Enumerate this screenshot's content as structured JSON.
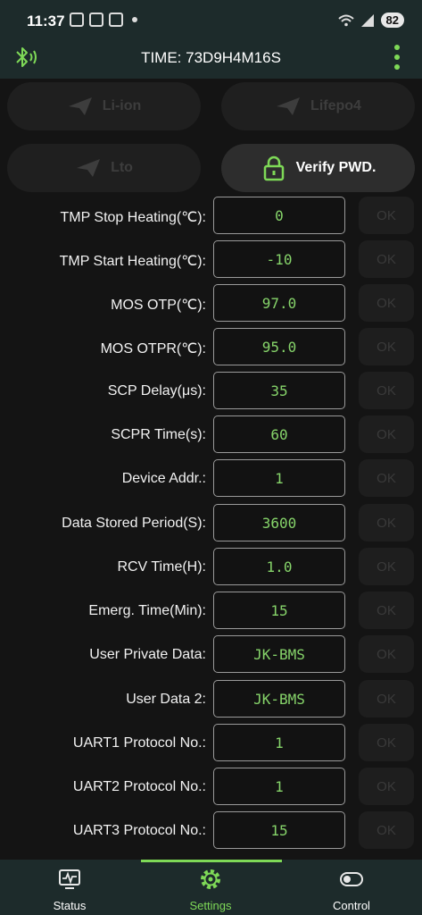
{
  "status_bar": {
    "time": "11:37",
    "battery": "82"
  },
  "app_bar": {
    "title": "TIME: 73D9H4M16S"
  },
  "presets": [
    {
      "label": "Li-ion"
    },
    {
      "label": "Lifepo4"
    },
    {
      "label": "Lto"
    }
  ],
  "verify_button": {
    "label": "Verify PWD."
  },
  "ok_label": "OK",
  "settings": [
    {
      "label": "TMP Stop Heating(℃):",
      "value": "0"
    },
    {
      "label": "TMP Start Heating(℃):",
      "value": "-10"
    },
    {
      "label": "MOS OTP(℃):",
      "value": "97.0"
    },
    {
      "label": "MOS OTPR(℃):",
      "value": "95.0"
    },
    {
      "label": "SCP Delay(μs):",
      "value": "35"
    },
    {
      "label": "SCPR Time(s):",
      "value": "60"
    },
    {
      "label": "Device Addr.:",
      "value": "1"
    },
    {
      "label": "Data Stored Period(S):",
      "value": "3600"
    },
    {
      "label": "RCV Time(H):",
      "value": "1.0"
    },
    {
      "label": "Emerg. Time(Min):",
      "value": "15"
    },
    {
      "label": "User Private Data:",
      "value": "JK-BMS"
    },
    {
      "label": "User Data 2:",
      "value": "JK-BMS"
    },
    {
      "label": "UART1 Protocol No.:",
      "value": "1"
    },
    {
      "label": "UART2 Protocol No.:",
      "value": "1"
    },
    {
      "label": "UART3 Protocol No.:",
      "value": "15"
    }
  ],
  "bottom_nav": [
    {
      "label": "Status",
      "icon": "monitor-icon"
    },
    {
      "label": "Settings",
      "icon": "gear-icon"
    },
    {
      "label": "Control",
      "icon": "toggle-icon"
    }
  ],
  "colors": {
    "accent": "#7ed957",
    "value_text": "#86d46a",
    "bar_bg": "#1d2b2b",
    "page_bg": "#141414"
  }
}
